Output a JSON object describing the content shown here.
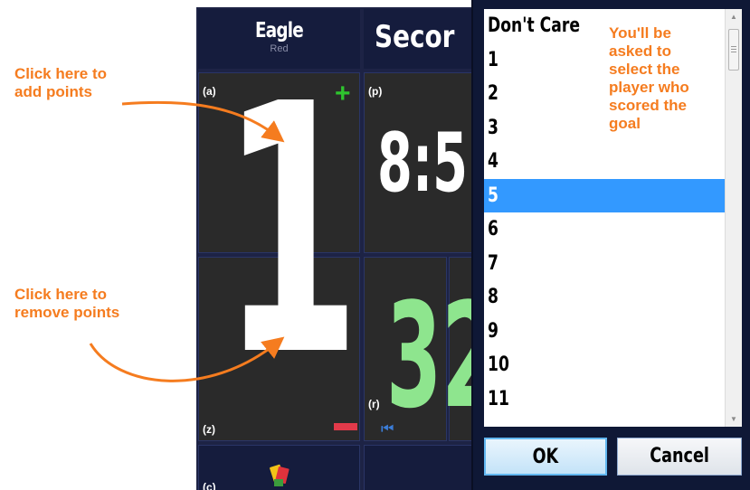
{
  "scoreboard": {
    "team_name": "Eagle",
    "team_color": "Red",
    "period_label": "Secor",
    "label_a": "(a)",
    "label_p": "(p)",
    "label_z": "(z)",
    "label_r": "(r)",
    "label_c": "(c)",
    "score": "1",
    "clock": "8:5",
    "shot_clock": "32",
    "plus_glyph": "+",
    "skip_glyph": "⏮"
  },
  "annotations": {
    "add_points": [
      "Click here to",
      "add points"
    ],
    "remove_points": [
      "Click here to",
      "remove points"
    ],
    "select_player": [
      "You'll be",
      "asked to",
      "select the",
      "player who",
      "scored the",
      "goal"
    ]
  },
  "dialog": {
    "items": [
      "Don't Care",
      "1",
      "2",
      "3",
      "4",
      "5",
      "6",
      "7",
      "8",
      "9",
      "10",
      "11"
    ],
    "selected_index": 5,
    "ok_label": "OK",
    "cancel_label": "Cancel"
  },
  "colors": {
    "annotation": "#f57c1f",
    "selection": "#3399ff",
    "plus": "#2ec42e",
    "minus": "#e23a4a",
    "shot_clock": "#8ee58e",
    "board_bg": "#1d2345"
  }
}
